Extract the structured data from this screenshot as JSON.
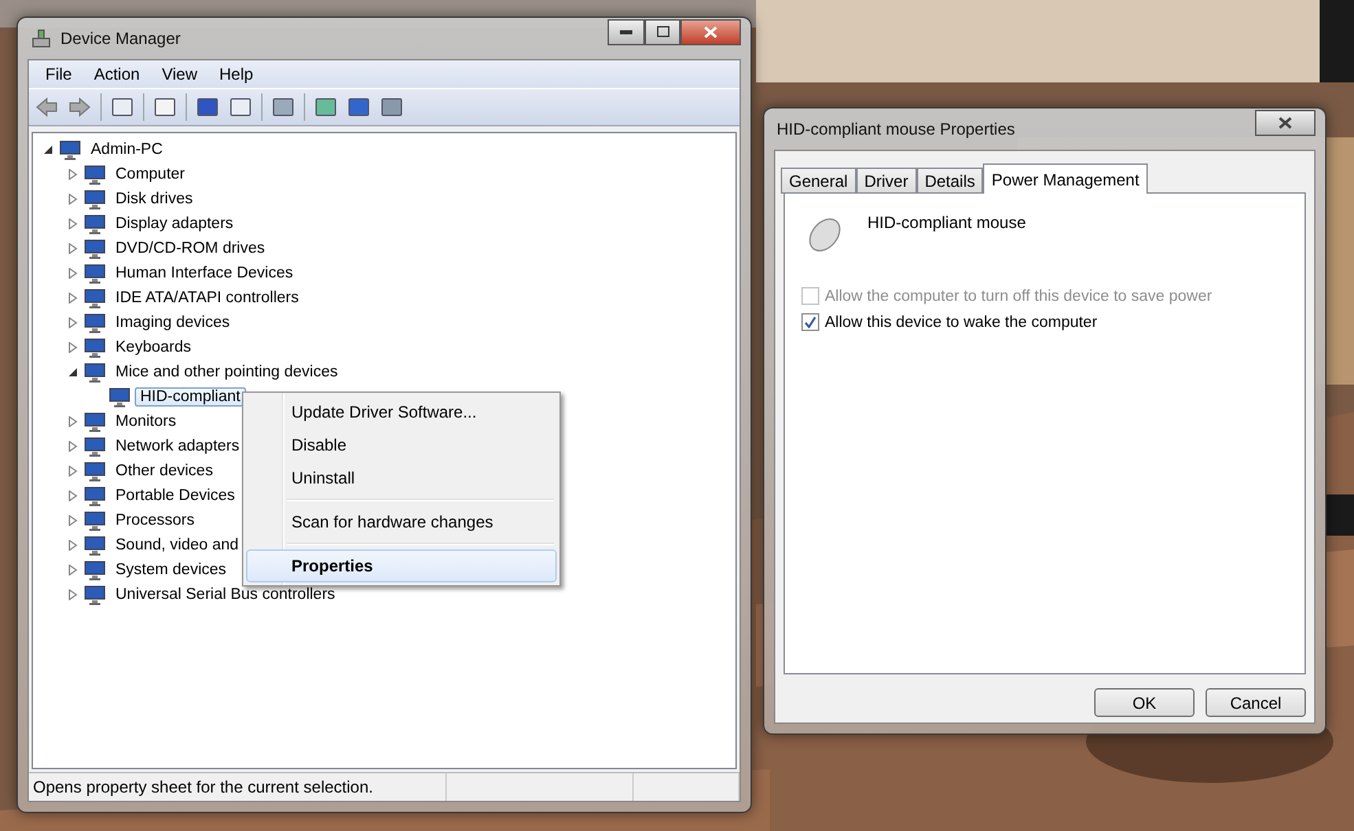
{
  "device_manager": {
    "title": "Device Manager",
    "menu": [
      "File",
      "Action",
      "View",
      "Help"
    ],
    "tree": {
      "label": "Admin-PC",
      "expanded": true,
      "selected": false,
      "children": [
        {
          "label": "Computer",
          "expanded": false,
          "selected": false
        },
        {
          "label": "Disk drives",
          "expanded": false,
          "selected": false
        },
        {
          "label": "Display adapters",
          "expanded": false,
          "selected": false
        },
        {
          "label": "DVD/CD-ROM drives",
          "expanded": false,
          "selected": false
        },
        {
          "label": "Human Interface Devices",
          "expanded": false,
          "selected": false
        },
        {
          "label": "IDE ATA/ATAPI controllers",
          "expanded": false,
          "selected": false
        },
        {
          "label": "Imaging devices",
          "expanded": false,
          "selected": false
        },
        {
          "label": "Keyboards",
          "expanded": false,
          "selected": false
        },
        {
          "label": "Mice and other pointing devices",
          "expanded": true,
          "selected": false,
          "children": [
            {
              "label": "HID-compliant",
              "selected": true
            }
          ]
        },
        {
          "label": "Monitors",
          "expanded": false,
          "selected": false
        },
        {
          "label": "Network adapters",
          "expanded": false,
          "selected": false
        },
        {
          "label": "Other devices",
          "expanded": false,
          "selected": false
        },
        {
          "label": "Portable Devices",
          "expanded": false,
          "selected": false
        },
        {
          "label": "Processors",
          "expanded": false,
          "selected": false
        },
        {
          "label": "Sound, video and",
          "expanded": false,
          "selected": false
        },
        {
          "label": "System devices",
          "expanded": false,
          "selected": false
        },
        {
          "label": "Universal Serial Bus controllers",
          "expanded": false,
          "selected": false
        }
      ]
    },
    "status_bar": "Opens property sheet for the current selection."
  },
  "context_menu": [
    {
      "kind": "item",
      "label": "Update Driver Software...",
      "selected": false,
      "default": false
    },
    {
      "kind": "item",
      "label": "Disable",
      "selected": false,
      "default": false
    },
    {
      "kind": "item",
      "label": "Uninstall",
      "selected": false,
      "default": false
    },
    {
      "kind": "separator"
    },
    {
      "kind": "item",
      "label": "Scan for hardware changes",
      "selected": false,
      "default": false
    },
    {
      "kind": "separator"
    },
    {
      "kind": "item",
      "label": "Properties",
      "selected": true,
      "default": true
    }
  ],
  "properties": {
    "title": "HID-compliant mouse Properties",
    "tabs": [
      {
        "label": "General",
        "selected": false
      },
      {
        "label": "Driver",
        "selected": false
      },
      {
        "label": "Details",
        "selected": false
      },
      {
        "label": "Power Management",
        "selected": true
      }
    ],
    "device_name": "HID-compliant mouse",
    "options": [
      {
        "label": "Allow the computer to turn off this device to save power",
        "checked": false,
        "disabled": true
      },
      {
        "label": "Allow this device to wake the computer",
        "checked": true,
        "disabled": false
      }
    ],
    "buttons": [
      "OK",
      "Cancel"
    ]
  }
}
